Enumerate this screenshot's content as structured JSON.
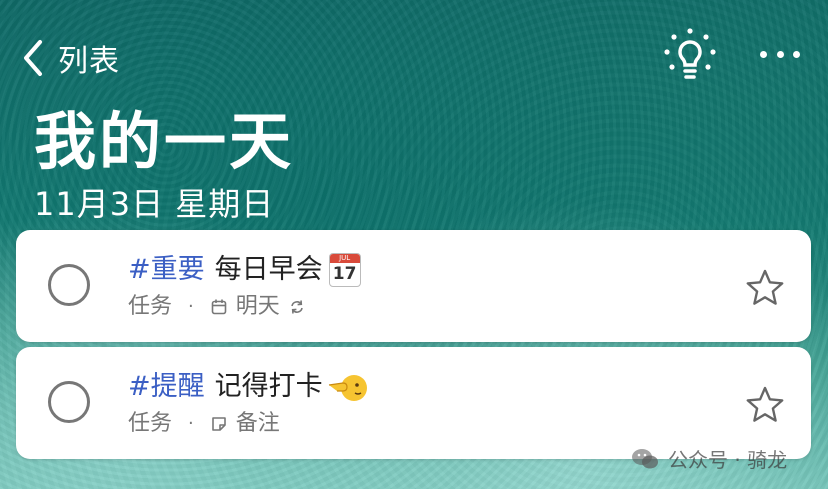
{
  "header": {
    "back_label": "列表",
    "title": "我的一天",
    "date": "11月3日 星期日",
    "icons": [
      "chevron-left-icon",
      "lightbulb-icon",
      "more-icon"
    ]
  },
  "tasks": [
    {
      "tag": "#重要",
      "title": "每日早会",
      "emoji": "calendar-emoji",
      "emoji_month": "JUL",
      "emoji_day": "17",
      "list": "任务",
      "separator": "·",
      "due": "明天",
      "has_repeat": true,
      "has_note": false,
      "starred": false
    },
    {
      "tag": "#提醒",
      "title": "记得打卡",
      "emoji": "pointing-hand-emoji",
      "list": "任务",
      "separator": "·",
      "note_label": "备注",
      "has_note": true,
      "starred": false
    }
  ],
  "watermark": {
    "text": "公众号 · 骑龙",
    "icon": "wechat-icon"
  },
  "colors": {
    "tag": "#3b5fc4",
    "meta": "#777777",
    "background": "#137b73"
  }
}
